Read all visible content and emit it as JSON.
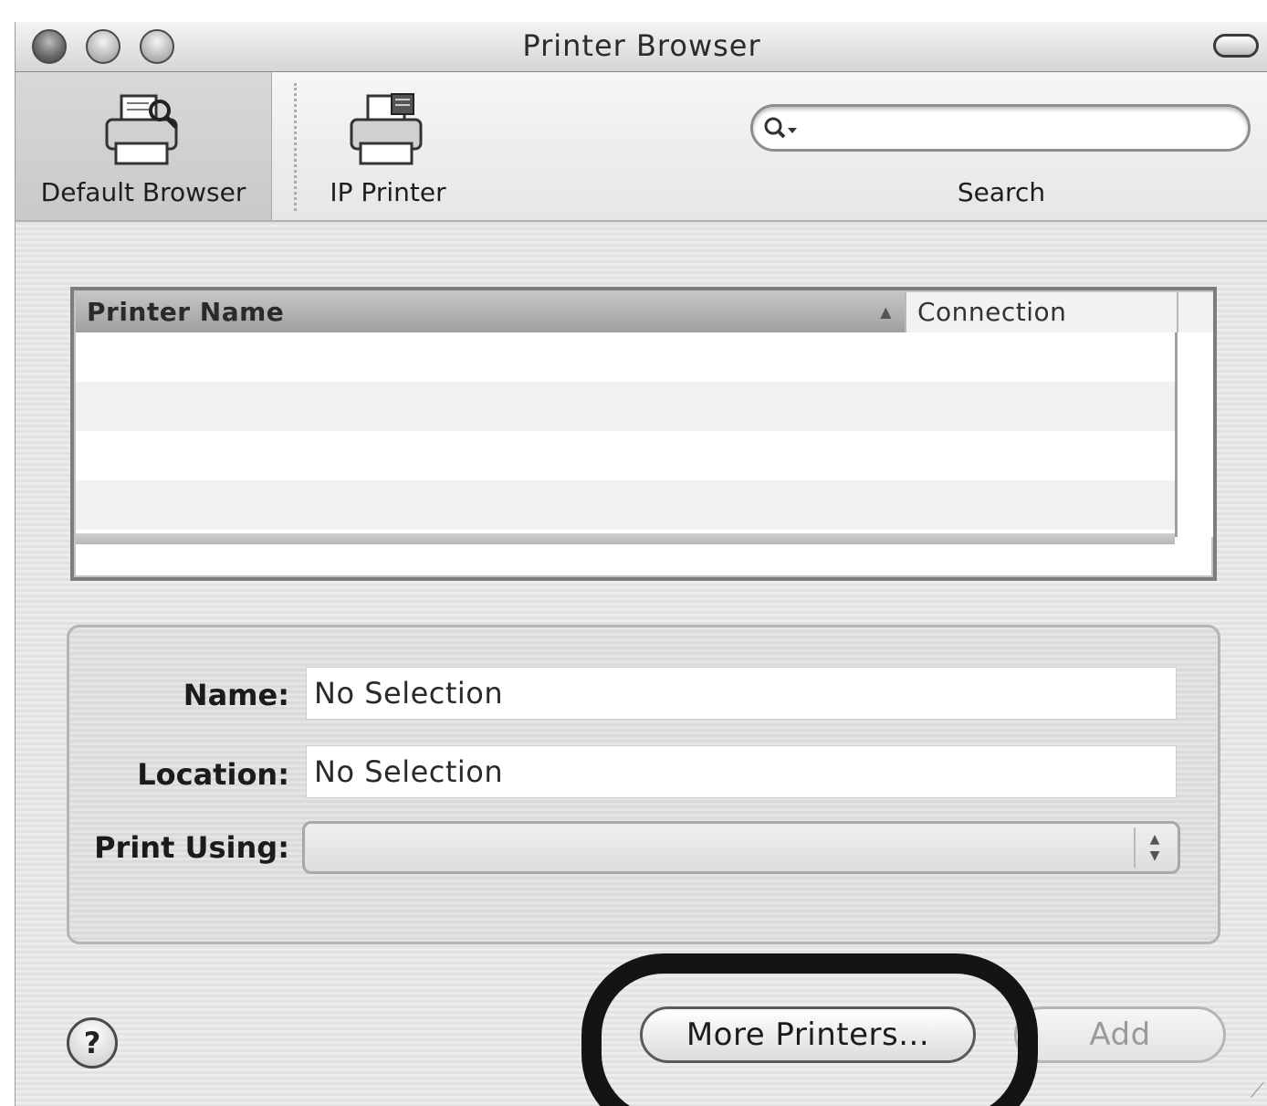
{
  "window": {
    "title": "Printer Browser"
  },
  "toolbar": {
    "items": [
      {
        "label": "Default Browser",
        "selected": true,
        "icon": "printer-browser-icon"
      },
      {
        "label": "IP Printer",
        "selected": false,
        "icon": "ip-printer-icon"
      }
    ],
    "search": {
      "label": "Search",
      "value": "",
      "icon": "magnifier-icon"
    }
  },
  "table": {
    "columns": [
      {
        "label": "Printer Name",
        "sort": "ascending"
      },
      {
        "label": "Connection"
      }
    ],
    "rows": []
  },
  "info": {
    "name_label": "Name:",
    "name_value": "No Selection",
    "location_label": "Location:",
    "location_value": "No Selection",
    "print_using_label": "Print Using:",
    "print_using_value": ""
  },
  "buttons": {
    "help_symbol": "?",
    "more_printers": "More Printers...",
    "add": "Add"
  }
}
